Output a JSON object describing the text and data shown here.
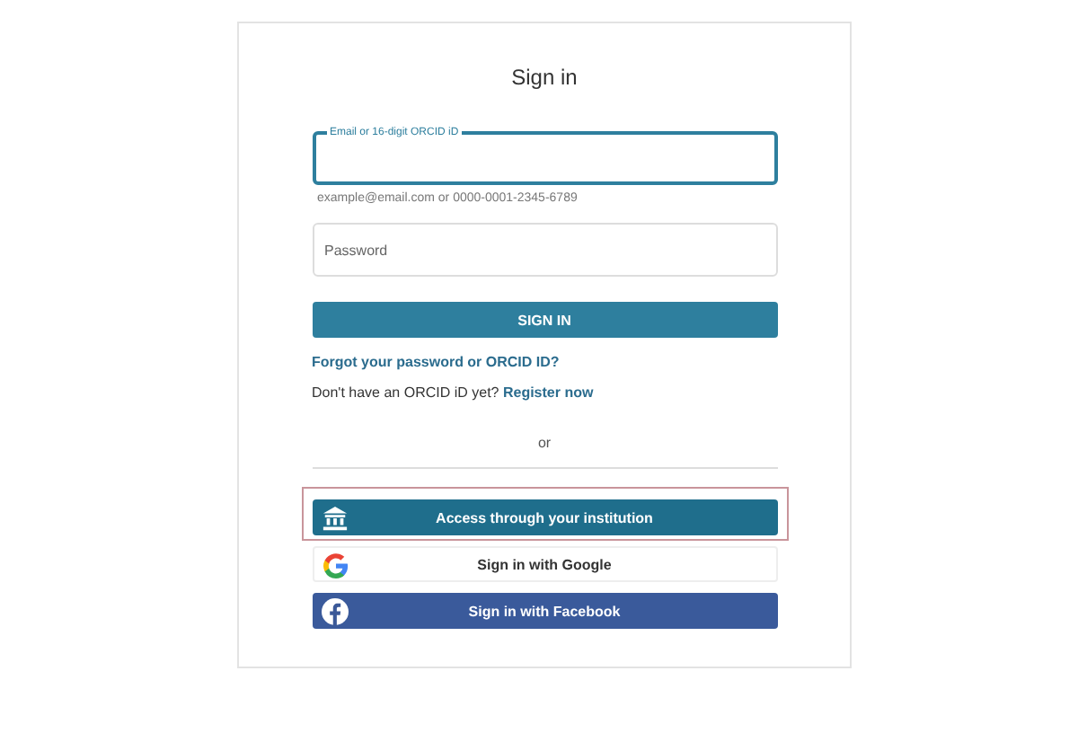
{
  "title": "Sign in",
  "email_field": {
    "label": "Email or 16-digit ORCID iD",
    "hint": "example@email.com or 0000-0001-2345-6789",
    "focused": true
  },
  "password_field": {
    "placeholder": "Password"
  },
  "sign_in_button": "SIGN IN",
  "forgot_link": "Forgot your password or ORCID ID?",
  "register": {
    "text": "Don't have an ORCID iD yet?",
    "link": "Register now"
  },
  "divider_text": "or",
  "providers": [
    {
      "kind": "institution",
      "label": "Access through your institution",
      "highlighted": true
    },
    {
      "kind": "google",
      "label": "Sign in with Google",
      "highlighted": false
    },
    {
      "kind": "facebook",
      "label": "Sign in with Facebook",
      "highlighted": false
    }
  ]
}
